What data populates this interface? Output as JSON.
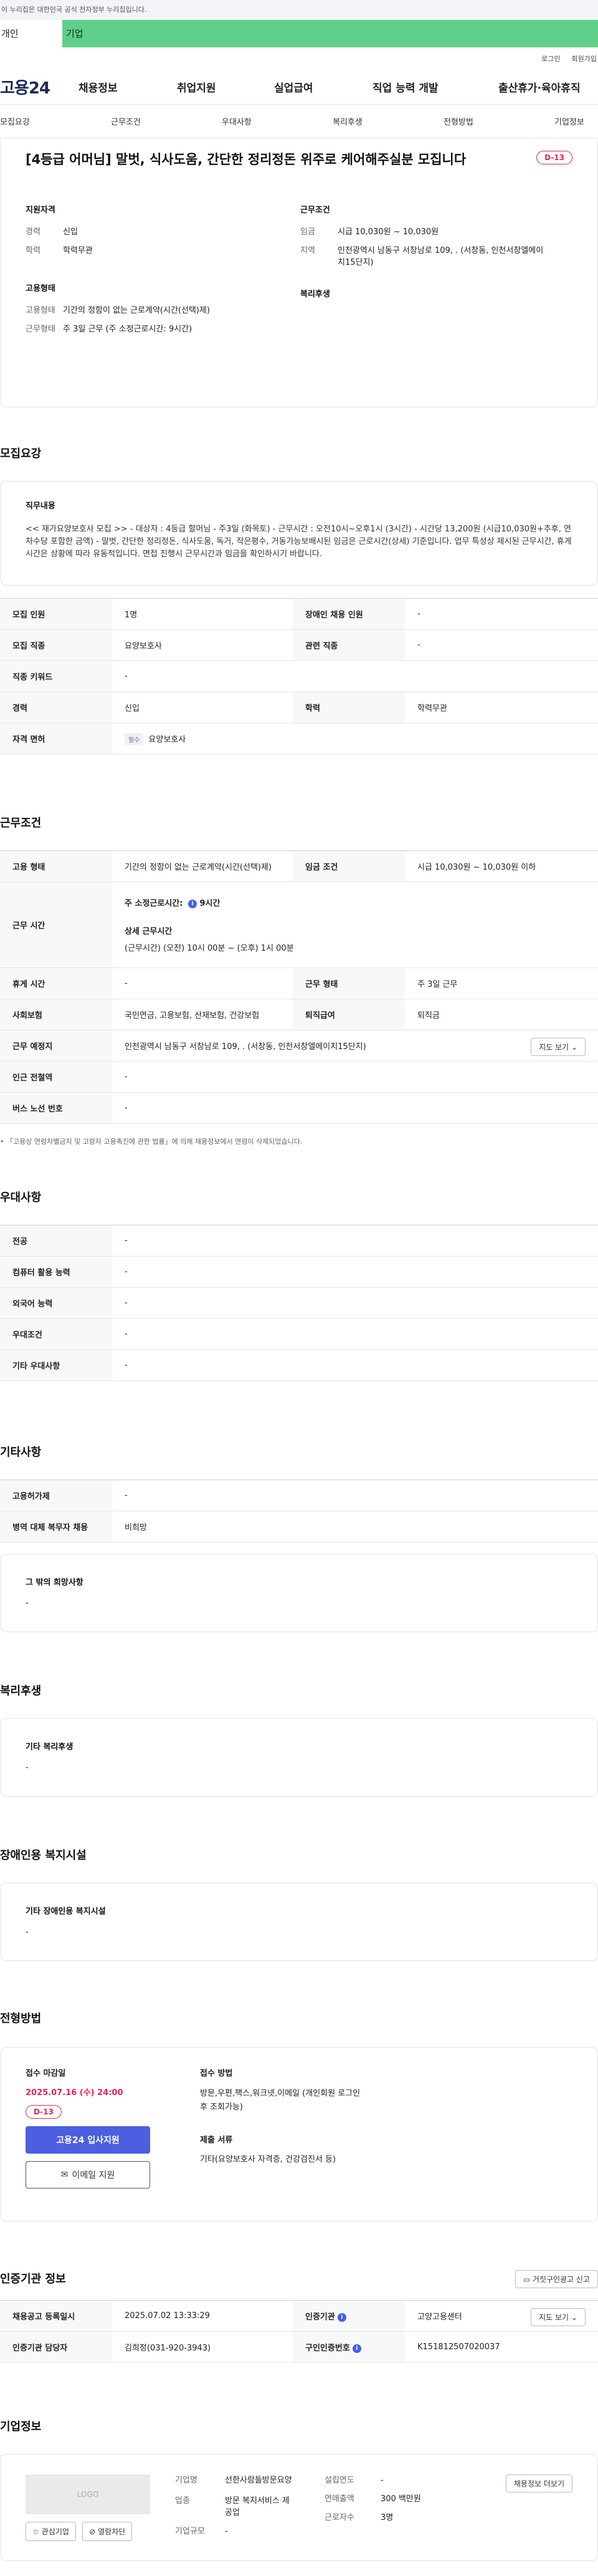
{
  "gov_bar": "이 누리집은 대한민국 공식 전자정부 누리집입니다.",
  "user_tabs": [
    "개인",
    "기업"
  ],
  "util_links": [
    "로그인",
    "회원가입"
  ],
  "logo": "고용24",
  "gnb": [
    "채용정보",
    "취업지원",
    "실업급여",
    "직업 능력 개발",
    "출산휴가·육아휴직"
  ],
  "lnb": [
    "모집요강",
    "근무조건",
    "우대사항",
    "복리후생",
    "전형방법",
    "기업정보"
  ],
  "title": "[4등급 어머님] 말벗, 식사도움, 간단한 정리정돈 위주로 케어해주실분 모집니다",
  "dday": "D-13",
  "summary": {
    "qual_head": "지원자격",
    "qual": [
      {
        "k": "경력",
        "v": "신입"
      },
      {
        "k": "학력",
        "v": "학력무관"
      }
    ],
    "emp_head": "고용형태",
    "emp": [
      {
        "k": "고용형태",
        "v": "기간의 정함이 없는 근로계약(시간(선택)제)"
      },
      {
        "k": "근무형태",
        "v": "주 3일 근무 (주 소정근로시간: 9시간)"
      }
    ],
    "cond_head": "근무조건",
    "cond": [
      {
        "k": "임금",
        "v": "시급 10,030원 ~ 10,030원"
      },
      {
        "k": "지역",
        "v": "인천광역시 남동구 서창남로 109, . (서창동, 인천서창엘에이치15단지)"
      }
    ],
    "welfare_head": "복리후생"
  },
  "recruit": {
    "heading": "모집요강",
    "job_label": "직무내용",
    "job_text": "<< 재가요양보호사 모집 >> - 대상자 : 4등급 할머님 - 주3일 (화목토)    - 근무시간 :  오전10시~오후1시 (3시간)    - 시간당 13,200원 (시급10,030원+추후, 연차수당 포함한 금액) - 말벗, 간단한 정리정돈, 식사도움, 독거, 작은평수, 거동가능보배시된 임금은 근로시간(상세) 기준입니다. 업무 특성상 제시된 근무시간, 휴게시간은 상황에 따라 유동적입니다. 면접 진행시 근무시간과 임금을 확인하시기 바랍니다.",
    "rows": [
      [
        {
          "k": "모집 인원",
          "v": "1명"
        },
        {
          "k": "장애인 채용 인원",
          "v": "-"
        }
      ],
      [
        {
          "k": "모집 직종",
          "v": "요양보호사"
        },
        {
          "k": "관련 직종",
          "v": "-"
        }
      ],
      [
        {
          "k": "직종 키워드",
          "v": "-"
        }
      ],
      [
        {
          "k": "경력",
          "v": "신입"
        },
        {
          "k": "학력",
          "v": "학력무관"
        }
      ]
    ],
    "license_k": "자격 면허",
    "license_tag": "필수",
    "license_v": "요양보호사"
  },
  "work": {
    "heading": "근무조건",
    "type_k": "고용 형태",
    "type_v": "기간의 정함이 없는 근로계약(시간(선택)제)",
    "wage_k": "임금 조건",
    "wage_v": "시급 10,030원 ~ 10,030원 이하",
    "time_k": "근무 시간",
    "time_main": "주 소정근로시간:",
    "time_main_v": "9시간",
    "time_detail_label": "상세 근무시간",
    "time_detail": "(근무시간) (오전) 10시 00분 ~ (오후) 1시 00분",
    "rest_k": "휴게 시간",
    "rest_v": "-",
    "form_k": "근무 형태",
    "form_v": "주 3일 근무",
    "ins_k": "사회보험",
    "ins_v": "국민연금, 고용보험, 산재보험, 건강보험",
    "ret_k": "퇴직급여",
    "ret_v": "퇴직금",
    "place_k": "근무 예정지",
    "place_v": "인천광역시 남동구 서창남로 109, . (서창동, 인천서창엘에이치15단지)",
    "map_btn": "지도 보기",
    "subway_k": "인근 전철역",
    "subway_v": "-",
    "bus_k": "버스 노선 번호",
    "bus_v": "-",
    "note": "「고용상 연령차별금지 및 고령자 고용촉진에 관한 법률」에 의해 채용정보에서 연령이 삭제되었습니다."
  },
  "pref": {
    "heading": "우대사항",
    "rows": [
      {
        "k": "전공",
        "v": "-"
      },
      {
        "k": "컴퓨터 활용 능력",
        "v": "-"
      },
      {
        "k": "외국어 능력",
        "v": "-"
      },
      {
        "k": "우대조건",
        "v": "-"
      },
      {
        "k": "기타 우대사항",
        "v": "-"
      }
    ]
  },
  "etc": {
    "heading": "기타사항",
    "rows": [
      {
        "k": "고용허가제",
        "v": "-"
      },
      {
        "k": "병역 대체 복무자 채용",
        "v": "비희망"
      }
    ],
    "other_label": "그 밖의 희망사항",
    "other_v": "-"
  },
  "welfare": {
    "heading": "복리후생",
    "label": "기타 복리후생",
    "v": "-"
  },
  "disabled": {
    "heading": "장애인용 복지시설",
    "label": "기타 장애인용 복지시설",
    "v": "-"
  },
  "process": {
    "heading": "전형방법",
    "deadline_label": "접수 마감일",
    "deadline": "2025.07.16 (수) 24:00",
    "dday": "D-13",
    "apply_btn": "고용24 입사지원",
    "email_btn": "이메일 지원",
    "method_label": "접수 방법",
    "method": "방문,우편,팩스,워크넷,이메일 (개인회원 로그인 후 조회가능)",
    "docs_label": "제출 서류",
    "docs": "기타(요양보호사 자격증, 건강검진서 등)"
  },
  "auth": {
    "heading": "인증기관 정보",
    "report_btn": "거짓구인광고 신고",
    "reg_k": "채용공고 등록일시",
    "reg_v": "2025.07.02 13:33:29",
    "org_k": "인증기관",
    "org_v": "고양고용센터",
    "map_btn": "지도 보기",
    "mgr_k": "인증기관 담당자",
    "mgr_v": "김희정(031-920-3943)",
    "num_k": "구인인증번호",
    "num_v": "K151812507020037"
  },
  "company": {
    "heading": "기업정보",
    "logo_text": "LOGO",
    "fav_btn": "관심기업",
    "block_btn": "열람차단",
    "name_k": "기업명",
    "name_v": "선한사람들방문요양",
    "ind_k": "업종",
    "ind_v": "방문 복지서비스 제공업",
    "scale_k": "기업규모",
    "scale_v": "-",
    "year_k": "설립연도",
    "year_v": "-",
    "sales_k": "연매출액",
    "sales_v": "300 백만원",
    "emp_k": "근로자수",
    "emp_v": "3명",
    "jobs_btn": "채용정보 더보기"
  }
}
